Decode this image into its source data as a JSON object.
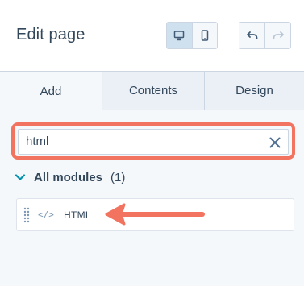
{
  "header": {
    "title": "Edit page",
    "view_buttons": [
      {
        "icon": "desktop-icon",
        "active": true
      },
      {
        "icon": "mobile-icon",
        "active": false
      }
    ],
    "history_buttons": [
      {
        "icon": "undo-icon",
        "enabled": true
      },
      {
        "icon": "redo-icon",
        "enabled": false
      }
    ]
  },
  "tabs": [
    {
      "label": "Add",
      "active": true
    },
    {
      "label": "Contents",
      "active": false
    },
    {
      "label": "Design",
      "active": false
    }
  ],
  "search": {
    "value": "html",
    "clear_icon": "close-icon",
    "highlight_color": "#f2735f"
  },
  "modules_section": {
    "label": "All modules",
    "count": "(1)",
    "expanded": true
  },
  "modules": [
    {
      "icon": "code-icon",
      "icon_text": "</>",
      "name": "HTML"
    }
  ],
  "annotation": {
    "arrow_color": "#f2735f"
  },
  "colors": {
    "text": "#33475b",
    "accent": "#f2735f",
    "chevron": "#0091ae"
  }
}
